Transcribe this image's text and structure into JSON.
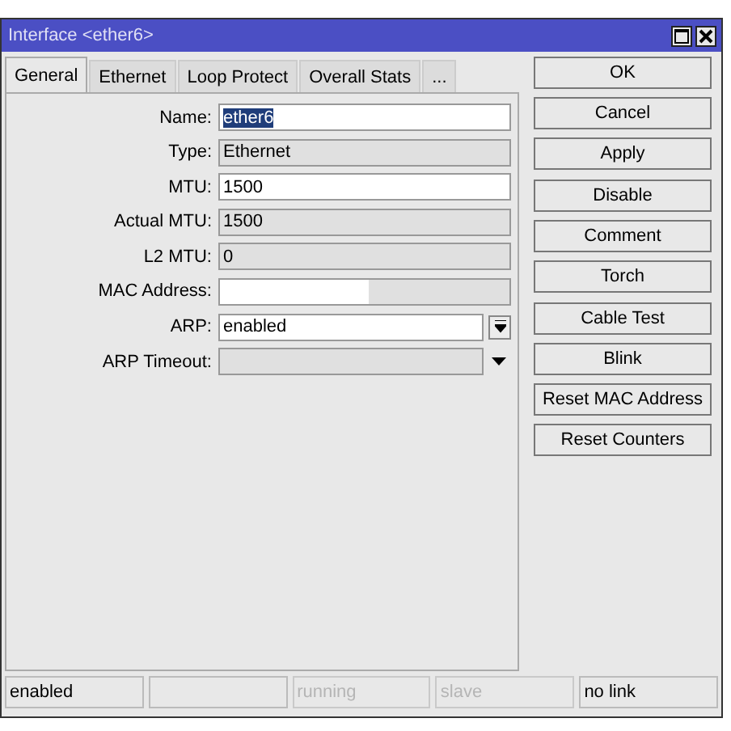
{
  "window": {
    "title": "Interface <ether6>"
  },
  "tabs": [
    {
      "label": "General",
      "selected": true
    },
    {
      "label": "Ethernet",
      "selected": false
    },
    {
      "label": "Loop Protect",
      "selected": false
    },
    {
      "label": "Overall Stats",
      "selected": false
    },
    {
      "label": "...",
      "selected": false
    }
  ],
  "fields": [
    {
      "label": "Name:",
      "kind": "edit",
      "value": "ether6",
      "selected": true
    },
    {
      "label": "Type:",
      "kind": "readonly",
      "value": "Ethernet"
    },
    {
      "label": "MTU:",
      "kind": "edit",
      "value": "1500",
      "selected": false
    },
    {
      "label": "Actual MTU:",
      "kind": "readonly",
      "value": "1500"
    },
    {
      "label": "L2 MTU:",
      "kind": "readonly",
      "value": "0"
    },
    {
      "label": "MAC Address:",
      "kind": "mac"
    },
    {
      "label": "ARP:",
      "kind": "dropdown",
      "value": "enabled"
    },
    {
      "label": "ARP Timeout:",
      "kind": "timeout"
    }
  ],
  "button_groups": [
    [
      "OK",
      "Cancel",
      "Apply"
    ],
    [
      "Disable",
      "Comment",
      "Torch"
    ],
    [
      "Cable Test",
      "Blink",
      "Reset MAC Address",
      "Reset Counters"
    ]
  ],
  "status_bar": [
    {
      "text": "enabled",
      "disabled": false
    },
    {
      "disabled": false
    },
    {
      "text": "running",
      "disabled": true
    },
    {
      "text": "slave",
      "disabled": true
    },
    {
      "text": "no link",
      "disabled": false
    }
  ]
}
